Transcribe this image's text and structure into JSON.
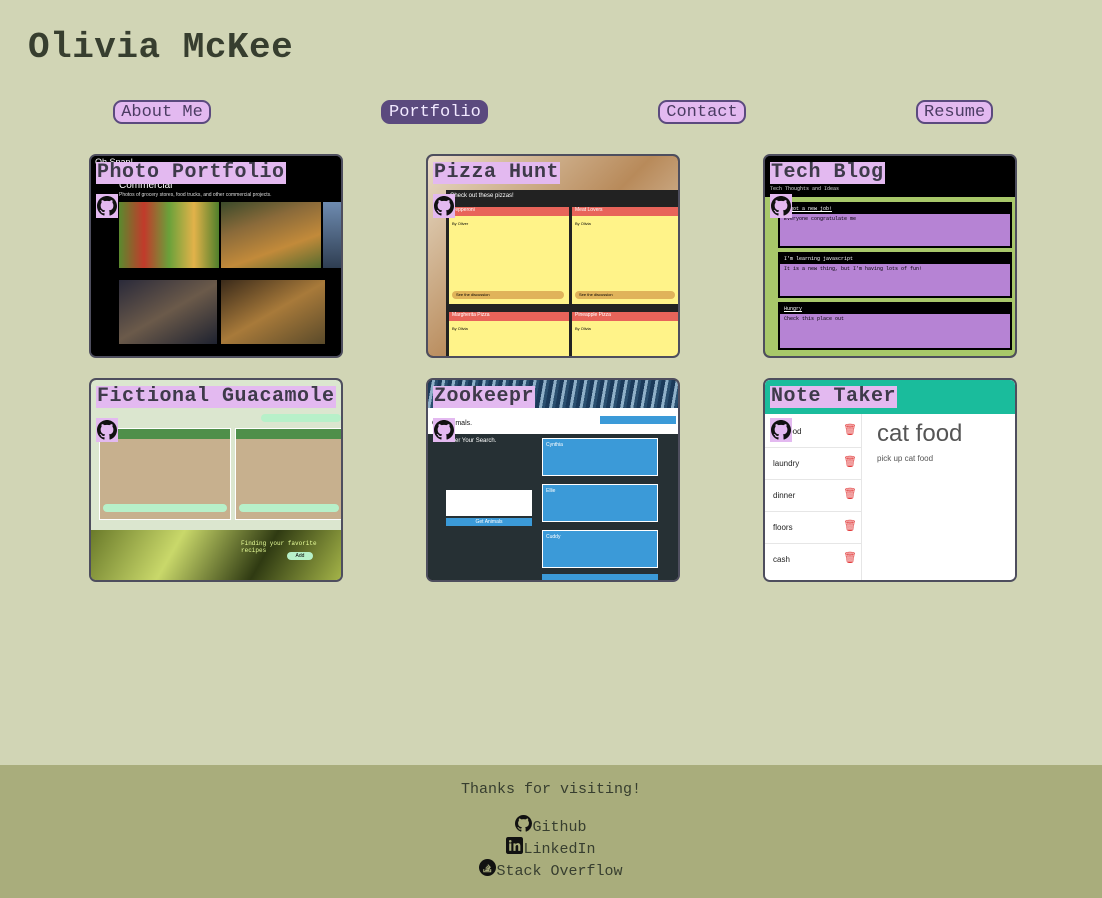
{
  "header": {
    "title": "Olivia McKee"
  },
  "nav": [
    {
      "label": "About Me",
      "active": false
    },
    {
      "label": "Portfolio",
      "active": true
    },
    {
      "label": "Contact",
      "active": false
    },
    {
      "label": "Resume",
      "active": false
    }
  ],
  "projects": [
    {
      "title": "Photo Portfolio",
      "preview": {
        "brand": "Oh Snap!",
        "heading": "Commercial",
        "caption": "Photos of grocery stores, food trucks, and other commercial projects."
      }
    },
    {
      "title": "Pizza Hunt",
      "preview": {
        "banner": "Check out these pizzas!",
        "cards": [
          {
            "name": "Pepperoni",
            "by": "By Oliver",
            "button": "See the discussion"
          },
          {
            "name": "Meat Lovers",
            "by": "By Olivia",
            "button": "See the discussion"
          },
          {
            "name": "Margherita Pizza",
            "by": "By Olivia"
          },
          {
            "name": "Pineapple Pizza",
            "by": "By Olivia"
          }
        ]
      }
    },
    {
      "title": "Tech Blog",
      "preview": {
        "subtitle": "Tech Thoughts and Ideas",
        "posts": [
          {
            "title": "I got a new job!",
            "body": "Everyone congratulate me"
          },
          {
            "title": "I'm learning javascript",
            "body": "It is a new thing, but I'm having lots of fun!"
          },
          {
            "title": "Hungry",
            "body": "Check this place out"
          }
        ]
      }
    },
    {
      "title": "Fictional Guacamole",
      "preview": {
        "tagline": "Finding your favorite recipes",
        "button": "Add"
      }
    },
    {
      "title": "Zookeepr",
      "preview": {
        "heading": "Our Animals.",
        "search": "Enter Your Search.",
        "button": "Get Animals",
        "animals": [
          "Cynthia",
          "Ellie",
          "Cuddy"
        ]
      }
    },
    {
      "title": "Note Taker",
      "preview": {
        "notes": [
          "cat food",
          "laundry",
          "dinner",
          "floors",
          "cash"
        ],
        "active_title": "cat food",
        "active_text": "pick up cat food"
      }
    }
  ],
  "icons": {
    "repo_link": "github-icon",
    "delete": "trash-icon"
  },
  "footer": {
    "thanks": "Thanks for visiting!",
    "links": [
      {
        "label": "Github",
        "icon": "github-icon"
      },
      {
        "label": "LinkedIn",
        "icon": "linkedin-icon"
      },
      {
        "label": "Stack Overflow",
        "icon": "stack-overflow-icon"
      }
    ]
  },
  "colors": {
    "background": "#d1d5b5",
    "footer": "#a9ad7c",
    "accent": "#e3b9f0",
    "accent_dark": "#5b4a7e"
  }
}
